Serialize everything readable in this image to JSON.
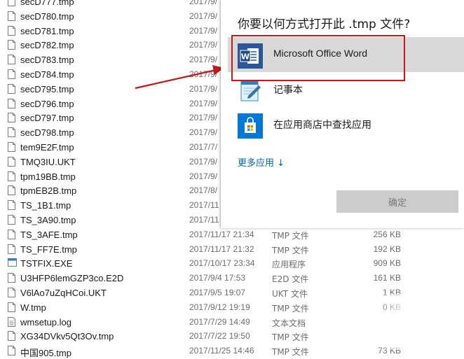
{
  "files": [
    {
      "name": "secD777.tmp",
      "date": "2017/9/",
      "type": "",
      "size": "",
      "icon": "doc"
    },
    {
      "name": "secD780.tmp",
      "date": "2017/9/",
      "type": "",
      "size": "",
      "icon": "doc"
    },
    {
      "name": "secD781.tmp",
      "date": "2017/9/",
      "type": "",
      "size": "",
      "icon": "doc"
    },
    {
      "name": "secD782.tmp",
      "date": "2017/9/",
      "type": "",
      "size": "",
      "icon": "doc"
    },
    {
      "name": "secD783.tmp",
      "date": "2017/9/",
      "type": "",
      "size": "",
      "icon": "doc"
    },
    {
      "name": "secD784.tmp",
      "date": "2017/9/",
      "type": "",
      "size": "",
      "icon": "doc"
    },
    {
      "name": "secD795.tmp",
      "date": "2017/9/",
      "type": "",
      "size": "",
      "icon": "doc"
    },
    {
      "name": "secD796.tmp",
      "date": "2017/9/",
      "type": "",
      "size": "",
      "icon": "doc"
    },
    {
      "name": "secD797.tmp",
      "date": "2017/9/",
      "type": "",
      "size": "",
      "icon": "doc"
    },
    {
      "name": "secD798.tmp",
      "date": "2017/9/",
      "type": "",
      "size": "",
      "icon": "doc"
    },
    {
      "name": "tem9E2F.tmp",
      "date": "2017/7/",
      "type": "",
      "size": "",
      "icon": "doc"
    },
    {
      "name": "TMQ3IU.UKT",
      "date": "2017/9/",
      "type": "",
      "size": "",
      "icon": "doc"
    },
    {
      "name": "tpm19BB.tmp",
      "date": "2017/9/",
      "type": "",
      "size": "",
      "icon": "doc"
    },
    {
      "name": "tpmEB2B.tmp",
      "date": "2017/8/",
      "type": "",
      "size": "",
      "icon": "doc"
    },
    {
      "name": "TS_1B1.tmp",
      "date": "2017/11",
      "type": "",
      "size": "",
      "icon": "doc"
    },
    {
      "name": "TS_3A90.tmp",
      "date": "2017/11",
      "type": "",
      "size": "",
      "icon": "doc"
    },
    {
      "name": "TS_3AFE.tmp",
      "date": "2017/11/17 21:34",
      "type": "TMP 文件",
      "size": "256 KB",
      "icon": "doc"
    },
    {
      "name": "TS_FF7E.tmp",
      "date": "2017/11/17 21:32",
      "type": "TMP 文件",
      "size": "192 KB",
      "icon": "doc"
    },
    {
      "name": "TSTFIX.EXE",
      "date": "2017/10/17 23:34",
      "type": "应用程序",
      "size": "909 KB",
      "icon": "exe"
    },
    {
      "name": "U3HFP6lemGZP3co.E2D",
      "date": "2017/9/4 17:53",
      "type": "E2D 文件",
      "size": "161 KB",
      "icon": "doc"
    },
    {
      "name": "V6lAo7uZqHCoi.UKT",
      "date": "2017/9/5 19:07",
      "type": "UKT 文件",
      "size": "1 KB",
      "icon": "doc"
    },
    {
      "name": "W.tmp",
      "date": "2017/9/12 19:19",
      "type": "TMP 文件",
      "size": "0 KB",
      "icon": "doc"
    },
    {
      "name": "wmsetup.log",
      "date": "2017/7/29 14:49",
      "type": "文本文档",
      "size": "",
      "icon": "txt"
    },
    {
      "name": "XG34DVkv5Qt3Ov.tmp",
      "date": "2017/7/22 19:50",
      "type": "TMP 文件",
      "size": "",
      "icon": "doc"
    },
    {
      "name": "中国905.tmp",
      "date": "2017/11/25 14:46",
      "type": "TMP 文件",
      "size": "73 KB",
      "icon": "doc"
    }
  ],
  "dialog": {
    "title": "你要以何方式打开此 .tmp 文件?",
    "options": [
      {
        "label": "Microsoft Office Word",
        "icon": "word-icon",
        "selected": true
      },
      {
        "label": "记事本",
        "icon": "notepad-icon",
        "selected": false
      },
      {
        "label": "在应用商店中查找应用",
        "icon": "store-icon",
        "selected": false
      }
    ],
    "more_apps": "更多应用 ↓",
    "ok_label": "确定"
  },
  "colors": {
    "highlight": "#c4181b",
    "accent": "#0063b1",
    "word_blue": "#2b579a"
  }
}
